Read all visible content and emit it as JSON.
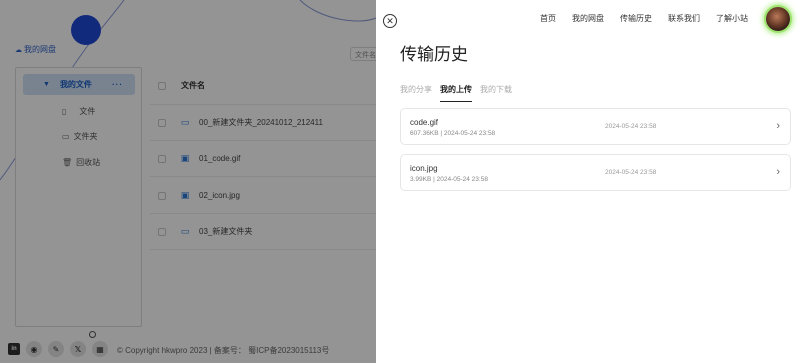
{
  "background": {
    "mycloud_label": "我的网盘",
    "tree": {
      "root_label": "我的文件",
      "root_more": "···",
      "items": [
        {
          "label": "文件",
          "icon": "file-icon"
        },
        {
          "label": "文件夹",
          "icon": "folder-icon"
        },
        {
          "label": "回收站",
          "icon": "trash-icon"
        }
      ]
    },
    "search_fragment": "文件名",
    "file_table": {
      "header": "文件名",
      "rows": [
        {
          "name": "00_新建文件夹_20241012_212411",
          "icon": "folder-icon"
        },
        {
          "name": "01_code.gif",
          "icon": "image-icon"
        },
        {
          "name": "02_icon.jpg",
          "icon": "image-icon"
        },
        {
          "name": "03_新建文件夹",
          "icon": "folder-icon"
        }
      ]
    },
    "footer": {
      "icons": [
        "linkedin-icon",
        "github-icon",
        "pen-icon",
        "x-icon",
        "calendar-icon"
      ],
      "copyright": "© Copyright hkwpro 2023 | 备案号：  蜀ICP备2023015113号"
    }
  },
  "drawer": {
    "close_label": "✕",
    "nav": [
      "首页",
      "我的网盘",
      "传输历史",
      "联系我们",
      "了解小站"
    ],
    "title": "传输历史",
    "tabs": [
      {
        "label": "我的分享",
        "active": false
      },
      {
        "label": "我的上传",
        "active": true
      },
      {
        "label": "我的下载",
        "active": false
      }
    ],
    "records": [
      {
        "name": "code.gif",
        "meta": "607.36KB | 2024-05-24 23:58",
        "time": "2024-05-24 23:58"
      },
      {
        "name": "icon.jpg",
        "meta": "3.99KB | 2024-05-24 23:58",
        "time": "2024-05-24 23:58"
      }
    ]
  },
  "colors": {
    "accent_blue": "#1f49d4",
    "selected_bg": "#cfe2f7",
    "avatar_glow": "#a6eb79"
  }
}
